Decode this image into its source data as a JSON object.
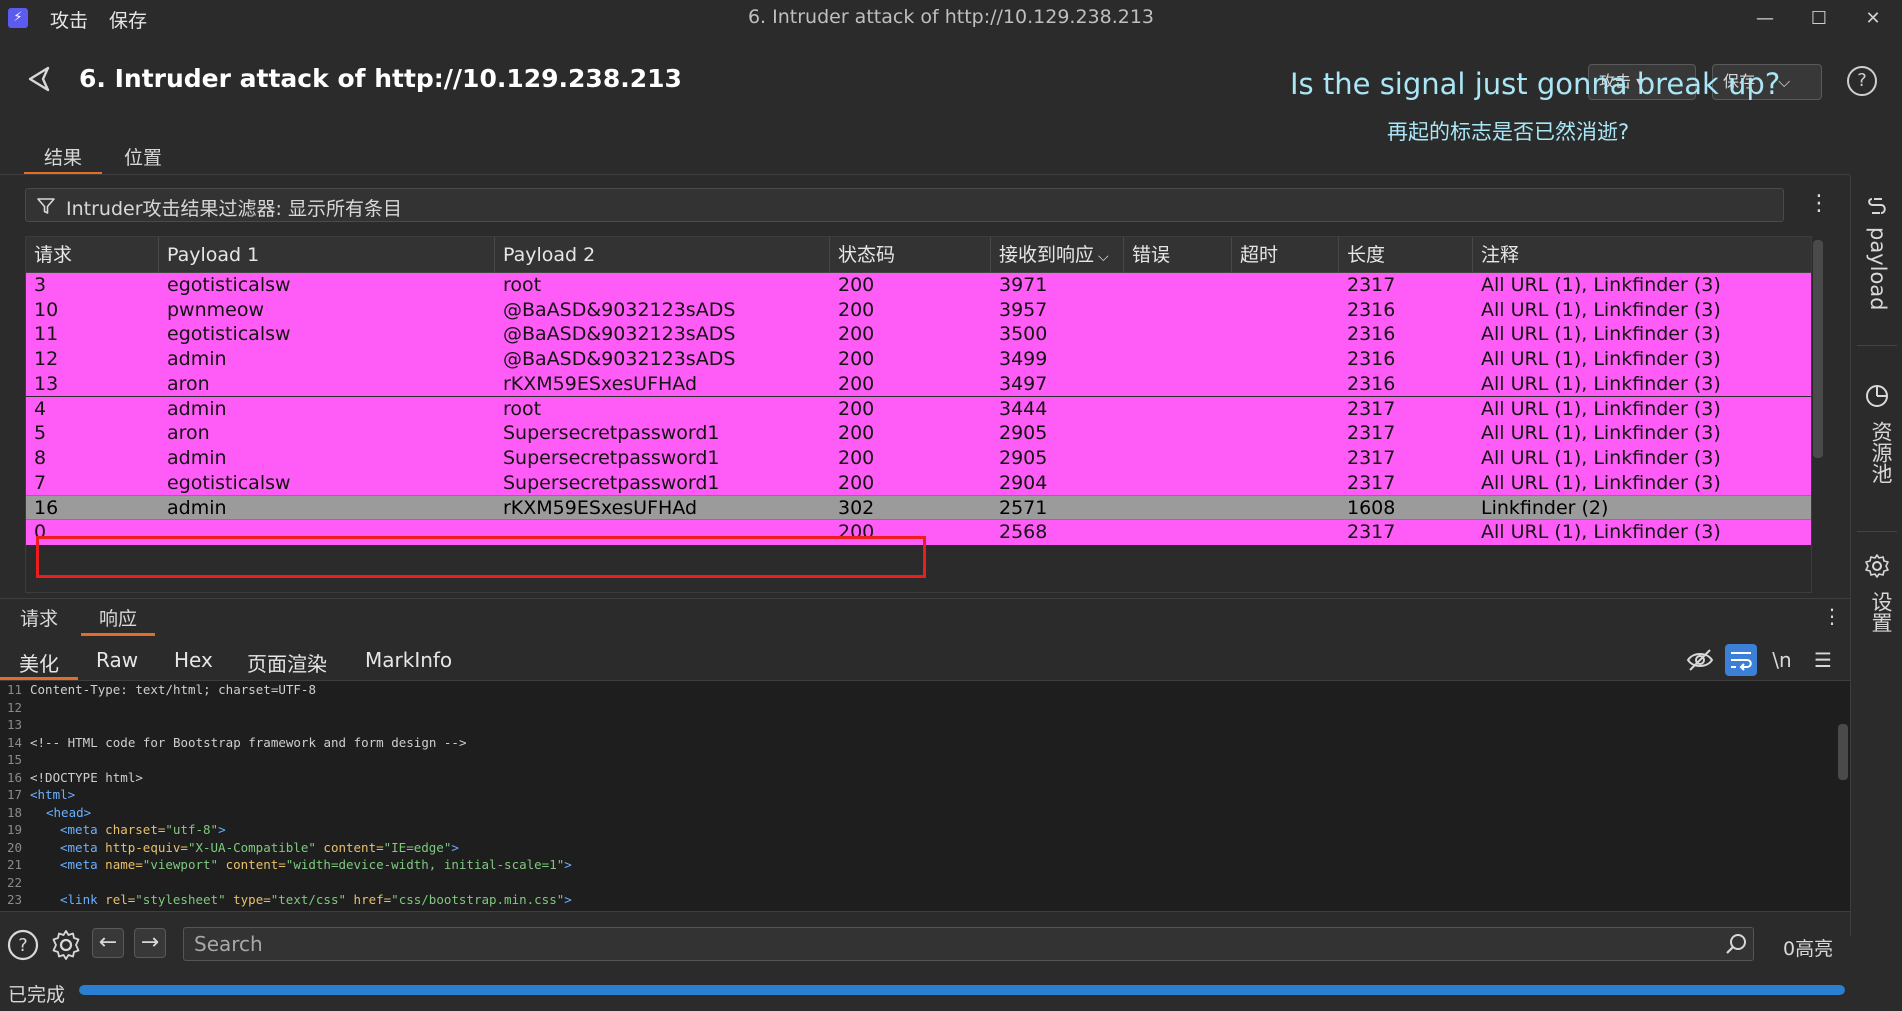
{
  "titlebar": {
    "menu": [
      "攻击",
      "保存"
    ],
    "window_title": "6. Intruder attack of http://10.129.238.213"
  },
  "header": {
    "title": "6. Intruder attack of http://10.129.238.213",
    "subtitle_en": "Is the signal just gonna break up?",
    "subtitle_zh": "再起的标志是否已然消逝?",
    "attack_button": "攻击 ▾",
    "save_button": "保存"
  },
  "tabs": [
    "结果",
    "位置"
  ],
  "filter": {
    "text": "Intruder攻击结果过滤器: 显示所有条目"
  },
  "table": {
    "columns": [
      "请求",
      "Payload 1",
      "Payload 2",
      "状态码",
      "接收到响应",
      "错误",
      "超时",
      "长度",
      "注释"
    ],
    "sort_indicator": "⌵",
    "rows": [
      {
        "req": "3",
        "p1": "egotisticalsw",
        "p2": "root",
        "status": "200",
        "recv": "3971",
        "err": "",
        "timeout": "",
        "len": "2317",
        "note": "All URL (1), Linkfinder (3)"
      },
      {
        "req": "10",
        "p1": "pwnmeow",
        "p2": "@BaASD&9032123sADS",
        "status": "200",
        "recv": "3957",
        "err": "",
        "timeout": "",
        "len": "2316",
        "note": "All URL (1), Linkfinder (3)"
      },
      {
        "req": "11",
        "p1": "egotisticalsw",
        "p2": "@BaASD&9032123sADS",
        "status": "200",
        "recv": "3500",
        "err": "",
        "timeout": "",
        "len": "2316",
        "note": "All URL (1), Linkfinder (3)"
      },
      {
        "req": "12",
        "p1": "admin",
        "p2": "@BaASD&9032123sADS",
        "status": "200",
        "recv": "3499",
        "err": "",
        "timeout": "",
        "len": "2316",
        "note": "All URL (1), Linkfinder (3)"
      },
      {
        "req": "13",
        "p1": "aron",
        "p2": "rKXM59ESxesUFHAd",
        "status": "200",
        "recv": "3497",
        "err": "",
        "timeout": "",
        "len": "2316",
        "note": "All URL (1), Linkfinder (3)"
      },
      {
        "req": "4",
        "p1": "admin",
        "p2": "root",
        "status": "200",
        "recv": "3444",
        "err": "",
        "timeout": "",
        "len": "2317",
        "note": "All URL (1), Linkfinder (3)"
      },
      {
        "req": "5",
        "p1": "aron",
        "p2": "Supersecretpassword1",
        "status": "200",
        "recv": "2905",
        "err": "",
        "timeout": "",
        "len": "2317",
        "note": "All URL (1), Linkfinder (3)"
      },
      {
        "req": "8",
        "p1": "admin",
        "p2": "Supersecretpassword1",
        "status": "200",
        "recv": "2905",
        "err": "",
        "timeout": "",
        "len": "2317",
        "note": "All URL (1), Linkfinder (3)"
      },
      {
        "req": "7",
        "p1": "egotisticalsw",
        "p2": "Supersecretpassword1",
        "status": "200",
        "recv": "2904",
        "err": "",
        "timeout": "",
        "len": "2317",
        "note": "All URL (1), Linkfinder (3)"
      },
      {
        "req": "16",
        "p1": "admin",
        "p2": "rKXM59ESxesUFHAd",
        "status": "302",
        "recv": "2571",
        "err": "",
        "timeout": "",
        "len": "1608",
        "note": "Linkfinder (2)",
        "selected": true
      },
      {
        "req": "0",
        "p1": "",
        "p2": "",
        "status": "200",
        "recv": "2568",
        "err": "",
        "timeout": "",
        "len": "2317",
        "note": "All URL (1), Linkfinder (3)"
      }
    ]
  },
  "sidebar": {
    "payload_label": "payload",
    "resources_label": "资源池",
    "settings_label": "设置"
  },
  "lower_tabs": [
    "请求",
    "响应"
  ],
  "viewer_tabs": [
    "美化",
    "Raw",
    "Hex",
    "页面渲染",
    "MarkInfo"
  ],
  "viewer_tools": {
    "newline": "\\n"
  },
  "code": {
    "line_numbers": [
      "11",
      "12",
      "13",
      "14",
      "15",
      "16",
      "17",
      "18",
      "19",
      "20",
      "21",
      "22",
      "23"
    ],
    "l11": "Content-Type: text/html; charset=UTF-8",
    "l14": "<!-- HTML code for Bootstrap framework and form design -->",
    "l16": "<!DOCTYPE html>",
    "l17": "<html>",
    "l18": "<head>",
    "l19_tag": "<meta",
    "l19_attr": " charset=",
    "l19_val": "\"utf-8\"",
    "l20_tag": "<meta",
    "l20_attr1": " http-equiv=",
    "l20_val1": "\"X-UA-Compatible\"",
    "l20_attr2": " content=",
    "l20_val2": "\"IE=edge\"",
    "l21_tag": "<meta",
    "l21_attr1": " name=",
    "l21_val1": "\"viewport\"",
    "l21_attr2": " content=",
    "l21_val2": "\"width=device-width, initial-scale=1\"",
    "l23_tag": "<link",
    "l23_attr1": " rel=",
    "l23_val1": "\"stylesheet\"",
    "l23_attr2": " type=",
    "l23_val2": "\"text/css\"",
    "l23_attr3": " href=",
    "l23_val3": "\"css/bootstrap.min.css\"",
    "close": ">"
  },
  "bottom": {
    "search_placeholder": "Search",
    "highlights": "0高亮"
  },
  "status": {
    "text": "已完成",
    "progress": 1.0
  },
  "colors": {
    "accent": "#e46c2a",
    "highlight_row": "#ff5cf7",
    "selected_row": "#9b9b9b",
    "annotation_box": "#ee1c1c",
    "progress": "#2a7fd0"
  }
}
